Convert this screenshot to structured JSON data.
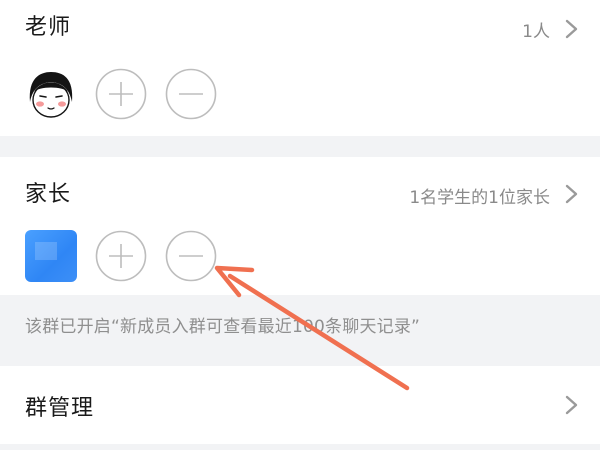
{
  "teacher": {
    "title": "老师",
    "count": "1人"
  },
  "parent": {
    "title": "家长",
    "summary": "1名学生的1位家长"
  },
  "notice": "该群已开启“新成员入群可查看最近100条聊天记录”",
  "manage": {
    "title": "群管理"
  },
  "colors": {
    "accent_arrow": "#f07050",
    "muted_text": "#8a8a8a",
    "avatar_blue": "#3a8df7"
  }
}
